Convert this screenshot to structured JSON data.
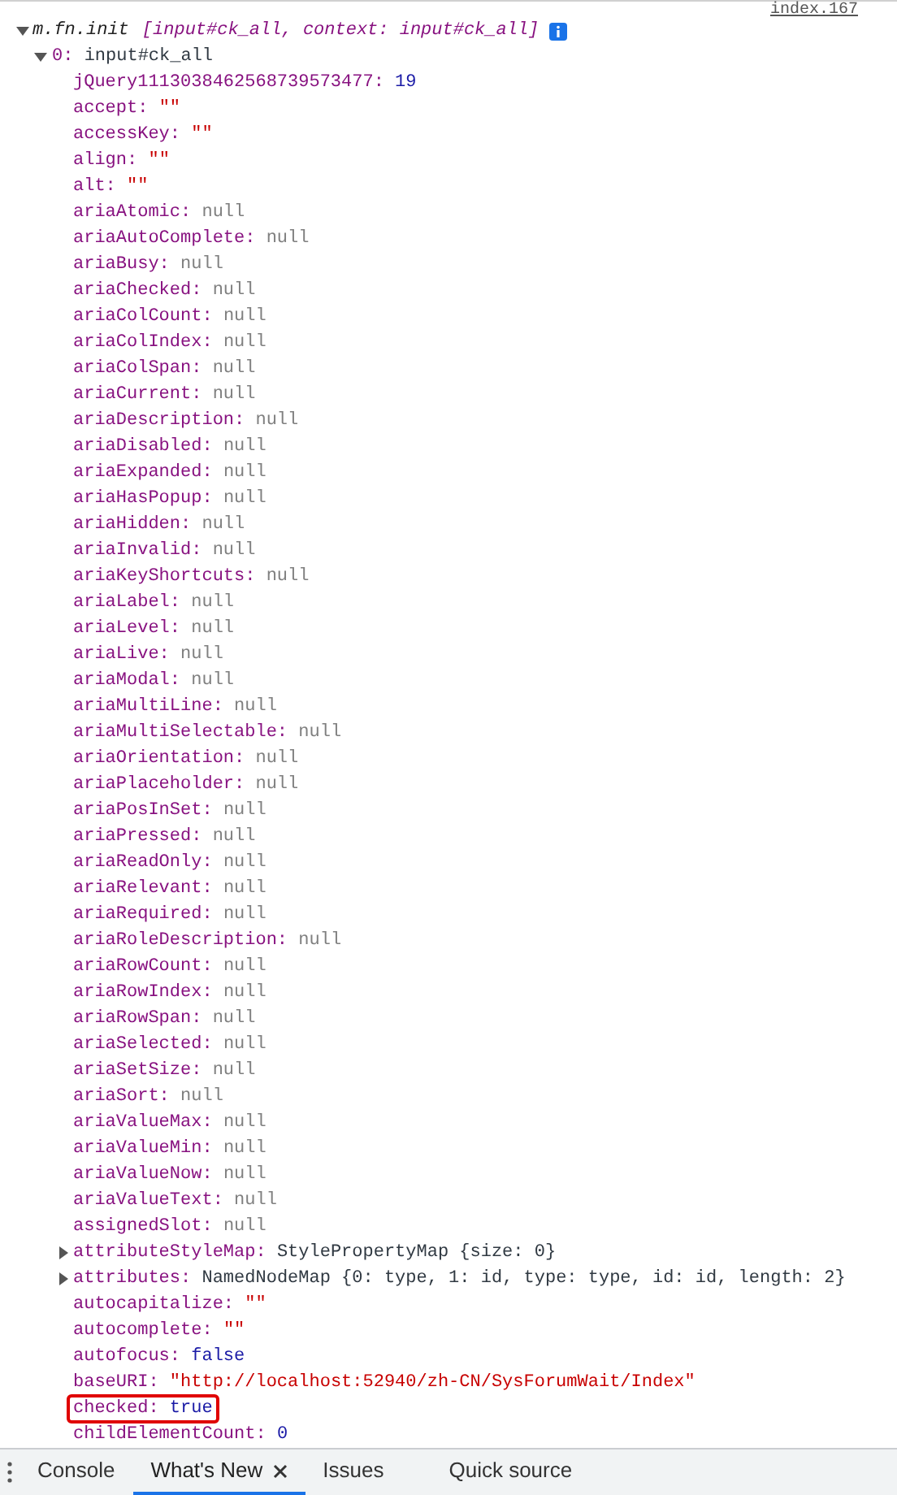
{
  "source_link": "index.167",
  "root": {
    "label": "m.fn.init",
    "summary": "[input#ck_all, context: input#ck_all]",
    "expanded": true
  },
  "element": {
    "key": "0:",
    "value": "input#ck_all",
    "expanded": true
  },
  "properties": [
    {
      "name": "jQuery1113038462568739573477:",
      "value": "19",
      "kind": "number",
      "highlighted": false
    },
    {
      "name": "accept:",
      "value": "\"\"",
      "kind": "string",
      "highlighted": false
    },
    {
      "name": "accessKey:",
      "value": "\"\"",
      "kind": "string",
      "highlighted": false
    },
    {
      "name": "align:",
      "value": "\"\"",
      "kind": "string",
      "highlighted": false
    },
    {
      "name": "alt:",
      "value": "\"\"",
      "kind": "string",
      "highlighted": false
    },
    {
      "name": "ariaAtomic:",
      "value": "null",
      "kind": "null",
      "highlighted": false
    },
    {
      "name": "ariaAutoComplete:",
      "value": "null",
      "kind": "null",
      "highlighted": false
    },
    {
      "name": "ariaBusy:",
      "value": "null",
      "kind": "null",
      "highlighted": false
    },
    {
      "name": "ariaChecked:",
      "value": "null",
      "kind": "null",
      "highlighted": false
    },
    {
      "name": "ariaColCount:",
      "value": "null",
      "kind": "null",
      "highlighted": false
    },
    {
      "name": "ariaColIndex:",
      "value": "null",
      "kind": "null",
      "highlighted": false
    },
    {
      "name": "ariaColSpan:",
      "value": "null",
      "kind": "null",
      "highlighted": false
    },
    {
      "name": "ariaCurrent:",
      "value": "null",
      "kind": "null",
      "highlighted": false
    },
    {
      "name": "ariaDescription:",
      "value": "null",
      "kind": "null",
      "highlighted": false
    },
    {
      "name": "ariaDisabled:",
      "value": "null",
      "kind": "null",
      "highlighted": false
    },
    {
      "name": "ariaExpanded:",
      "value": "null",
      "kind": "null",
      "highlighted": false
    },
    {
      "name": "ariaHasPopup:",
      "value": "null",
      "kind": "null",
      "highlighted": false
    },
    {
      "name": "ariaHidden:",
      "value": "null",
      "kind": "null",
      "highlighted": false
    },
    {
      "name": "ariaInvalid:",
      "value": "null",
      "kind": "null",
      "highlighted": false
    },
    {
      "name": "ariaKeyShortcuts:",
      "value": "null",
      "kind": "null",
      "highlighted": false
    },
    {
      "name": "ariaLabel:",
      "value": "null",
      "kind": "null",
      "highlighted": false
    },
    {
      "name": "ariaLevel:",
      "value": "null",
      "kind": "null",
      "highlighted": false
    },
    {
      "name": "ariaLive:",
      "value": "null",
      "kind": "null",
      "highlighted": false
    },
    {
      "name": "ariaModal:",
      "value": "null",
      "kind": "null",
      "highlighted": false
    },
    {
      "name": "ariaMultiLine:",
      "value": "null",
      "kind": "null",
      "highlighted": false
    },
    {
      "name": "ariaMultiSelectable:",
      "value": "null",
      "kind": "null",
      "highlighted": false
    },
    {
      "name": "ariaOrientation:",
      "value": "null",
      "kind": "null",
      "highlighted": false
    },
    {
      "name": "ariaPlaceholder:",
      "value": "null",
      "kind": "null",
      "highlighted": false
    },
    {
      "name": "ariaPosInSet:",
      "value": "null",
      "kind": "null",
      "highlighted": false
    },
    {
      "name": "ariaPressed:",
      "value": "null",
      "kind": "null",
      "highlighted": false
    },
    {
      "name": "ariaReadOnly:",
      "value": "null",
      "kind": "null",
      "highlighted": false
    },
    {
      "name": "ariaRelevant:",
      "value": "null",
      "kind": "null",
      "highlighted": false
    },
    {
      "name": "ariaRequired:",
      "value": "null",
      "kind": "null",
      "highlighted": false
    },
    {
      "name": "ariaRoleDescription:",
      "value": "null",
      "kind": "null",
      "highlighted": false
    },
    {
      "name": "ariaRowCount:",
      "value": "null",
      "kind": "null",
      "highlighted": false
    },
    {
      "name": "ariaRowIndex:",
      "value": "null",
      "kind": "null",
      "highlighted": false
    },
    {
      "name": "ariaRowSpan:",
      "value": "null",
      "kind": "null",
      "highlighted": false
    },
    {
      "name": "ariaSelected:",
      "value": "null",
      "kind": "null",
      "highlighted": false
    },
    {
      "name": "ariaSetSize:",
      "value": "null",
      "kind": "null",
      "highlighted": false
    },
    {
      "name": "ariaSort:",
      "value": "null",
      "kind": "null",
      "highlighted": false
    },
    {
      "name": "ariaValueMax:",
      "value": "null",
      "kind": "null",
      "highlighted": false
    },
    {
      "name": "ariaValueMin:",
      "value": "null",
      "kind": "null",
      "highlighted": false
    },
    {
      "name": "ariaValueNow:",
      "value": "null",
      "kind": "null",
      "highlighted": false
    },
    {
      "name": "ariaValueText:",
      "value": "null",
      "kind": "null",
      "highlighted": false
    },
    {
      "name": "assignedSlot:",
      "value": "null",
      "kind": "null",
      "highlighted": false
    },
    {
      "name": "attributeStyleMap:",
      "value": "StylePropertyMap {size: 0}",
      "kind": "object",
      "expanded": false,
      "highlighted": false
    },
    {
      "name": "attributes:",
      "value": "NamedNodeMap {0: type, 1: id, type: type, id: id, length: 2}",
      "kind": "object",
      "expanded": false,
      "highlighted": false
    },
    {
      "name": "autocapitalize:",
      "value": "\"\"",
      "kind": "string",
      "highlighted": false
    },
    {
      "name": "autocomplete:",
      "value": "\"\"",
      "kind": "string",
      "highlighted": false
    },
    {
      "name": "autofocus:",
      "value": "false",
      "kind": "boolean",
      "highlighted": false
    },
    {
      "name": "baseURI:",
      "value": "\"http://localhost:52940/zh-CN/SysForumWait/Index\"",
      "kind": "string",
      "highlighted": false
    },
    {
      "name": "checked:",
      "value": "true",
      "kind": "boolean",
      "highlighted": true
    },
    {
      "name": "childElementCount:",
      "value": "0",
      "kind": "number",
      "highlighted": false
    }
  ],
  "tabs": [
    {
      "label": "Console",
      "selected": false,
      "closable": false
    },
    {
      "label": "What's New",
      "selected": true,
      "closable": true
    },
    {
      "label": "Issues",
      "selected": false,
      "closable": false
    },
    {
      "label": "Quick source",
      "selected": false,
      "closable": false
    }
  ]
}
